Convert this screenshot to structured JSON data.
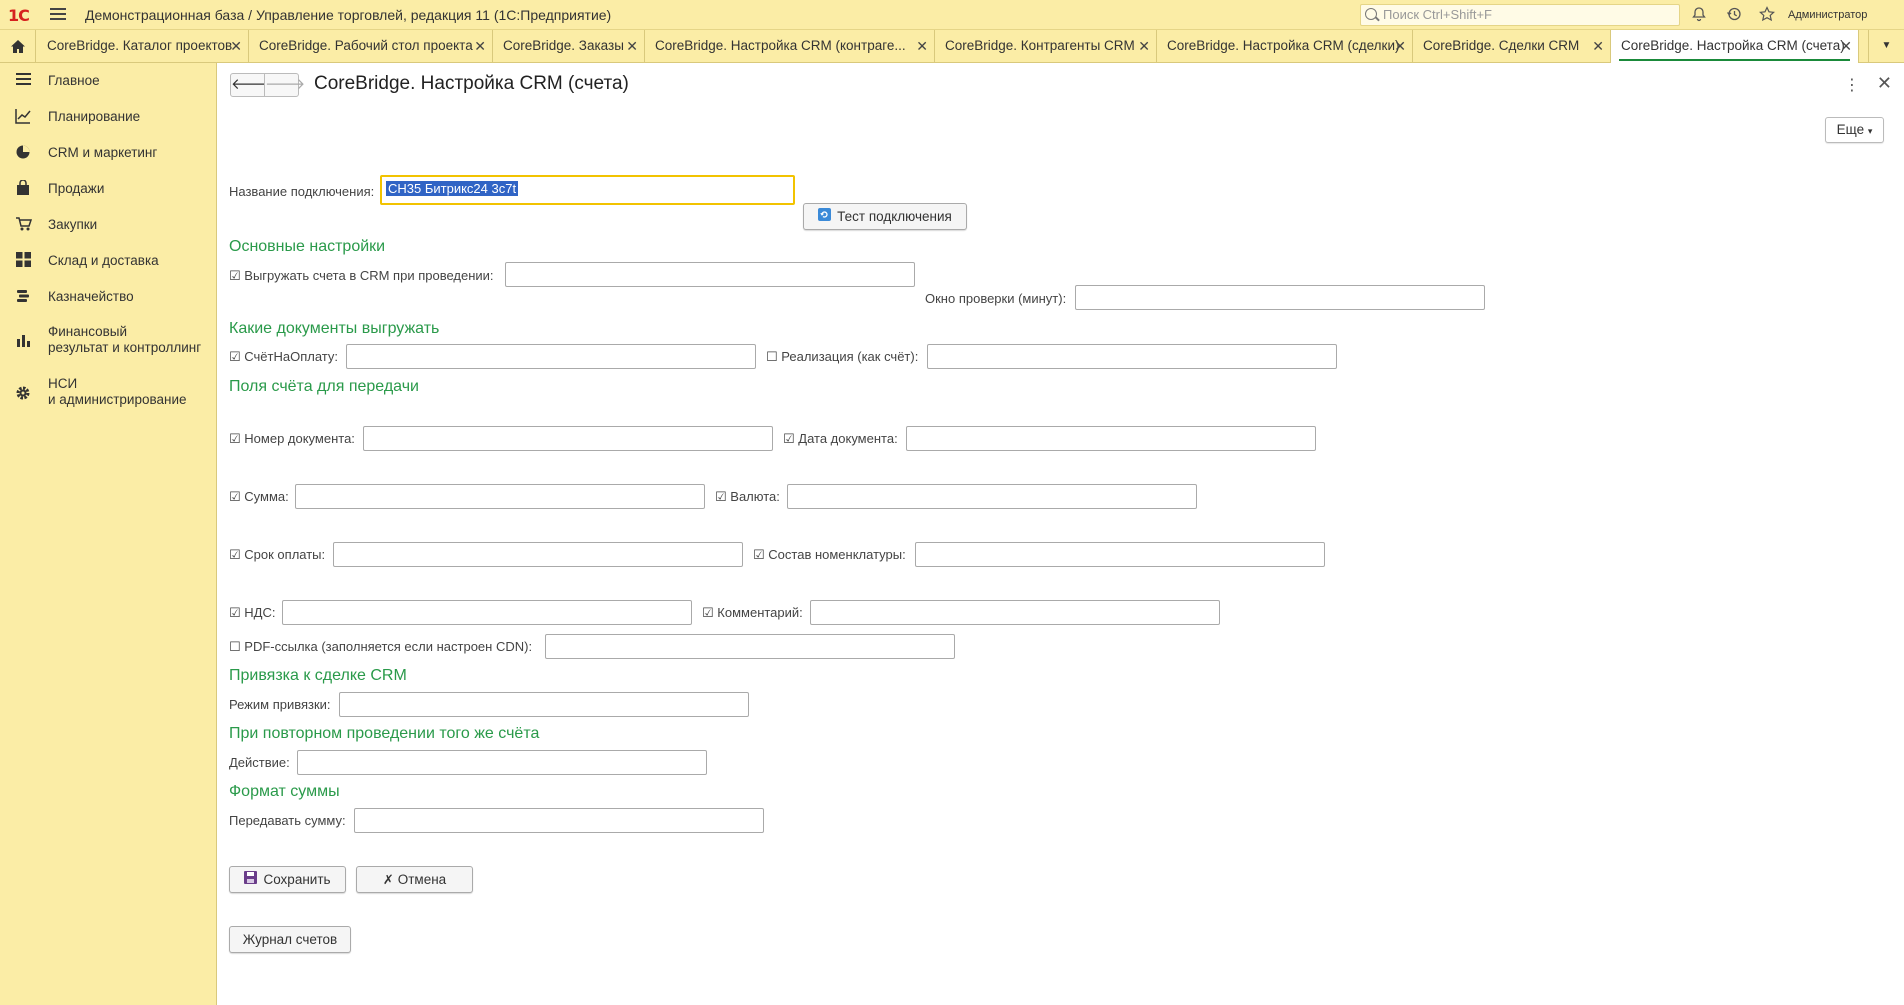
{
  "header": {
    "logo": "1С",
    "title": "Демонстрационная база / Управление торговлей, редакция 11  (1С:Предприятие)",
    "search_placeholder": "Поиск Ctrl+Shift+F",
    "user": "Администратор"
  },
  "tabs": [
    {
      "label": "CoreBridge. Каталог проектов"
    },
    {
      "label": "CoreBridge. Рабочий стол проекта"
    },
    {
      "label": "CoreBridge. Заказы"
    },
    {
      "label": "CoreBridge. Настройка CRM (контраге..."
    },
    {
      "label": "CoreBridge. Контрагенты CRM"
    },
    {
      "label": "CoreBridge. Настройка CRM (сделки)"
    },
    {
      "label": "CoreBridge. Сделки CRM"
    },
    {
      "label": "CoreBridge. Настройка CRM (счета)"
    }
  ],
  "sidebar": {
    "items": [
      {
        "label": "Главное"
      },
      {
        "label": "Планирование"
      },
      {
        "label": "CRM и маркетинг"
      },
      {
        "label": "Продажи"
      },
      {
        "label": "Закупки"
      },
      {
        "label": "Склад и доставка"
      },
      {
        "label": "Казначейство"
      },
      {
        "label": "Финансовый\nрезультат и контроллинг"
      },
      {
        "label": "НСИ\nи администрирование"
      }
    ]
  },
  "form": {
    "title": "CoreBridge. Настройка CRM (счета)",
    "more_label": "Еще",
    "connection_label": "Название подключения:",
    "connection_value": "СН35 Битрикс24 3c7t",
    "test_button": "Тест подключения",
    "sections": {
      "basic": "Основные настройки",
      "docs": "Какие документы выгружать",
      "fields": "Поля счёта для передачи",
      "deal": "Привязка к сделке CRM",
      "repost": "При повторном проведении того же счёта",
      "sum_format": "Формат суммы"
    },
    "labels": {
      "export_on_post": "Выгружать счета в CRM при проведении:",
      "check_window": "Окно проверки (минут):",
      "invoice": "СчётНаОплату:",
      "realization": "Реализация (как счёт):",
      "doc_number": "Номер документа:",
      "doc_date": "Дата документа:",
      "amount": "Сумма:",
      "currency": "Валюта:",
      "due_date": "Срок оплаты:",
      "nomenclature": "Состав номенклатуры:",
      "vat": "НДС:",
      "comment": "Комментарий:",
      "pdf_link": "PDF-ссылка (заполняется если настроен CDN):",
      "link_mode": "Режим привязки:",
      "action": "Действие:",
      "pass_amount": "Передавать сумму:"
    },
    "checked": "☑",
    "unchecked": "☐",
    "save_button": "Сохранить",
    "cancel_button": "Отмена",
    "journal_button": "Журнал счетов"
  }
}
